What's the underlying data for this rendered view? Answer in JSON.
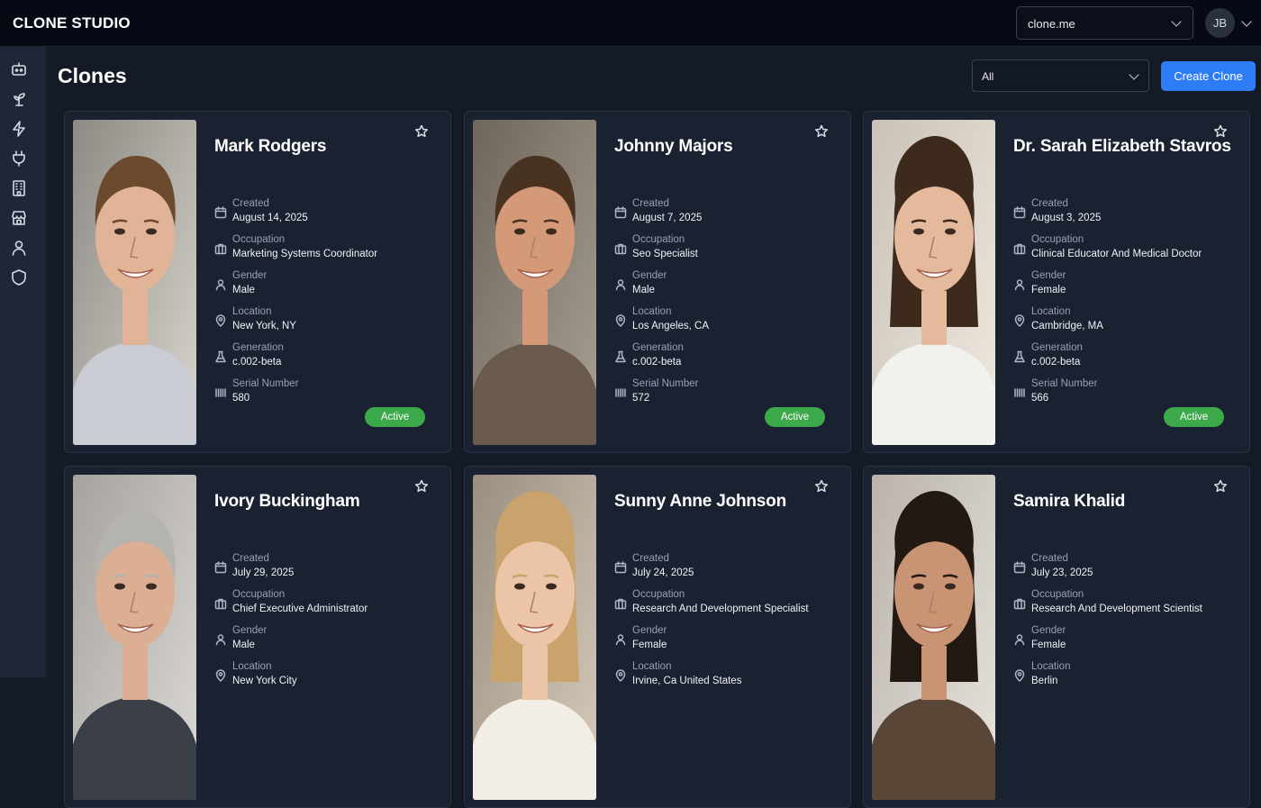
{
  "app": {
    "brand": "CLONE STUDIO"
  },
  "header": {
    "domain_selector": {
      "value": "clone.me"
    },
    "user": {
      "initials": "JB"
    }
  },
  "sidebar": {
    "items": [
      {
        "icon": "robot-icon"
      },
      {
        "icon": "sprout-icon"
      },
      {
        "icon": "lightning-icon"
      },
      {
        "icon": "plug-icon"
      },
      {
        "icon": "building-icon"
      },
      {
        "icon": "store-icon"
      },
      {
        "icon": "user-icon"
      },
      {
        "icon": "shield-icon"
      }
    ]
  },
  "main": {
    "title": "Clones",
    "filter": {
      "value": "All"
    },
    "create_label": "Create Clone"
  },
  "field_labels": {
    "created": "Created",
    "occupation": "Occupation",
    "gender": "Gender",
    "location": "Location",
    "generation": "Generation",
    "serial": "Serial Number"
  },
  "cards": [
    {
      "name": "Mark Rodgers",
      "created": "August 14, 2025",
      "occupation": "Marketing Systems Coordinator",
      "gender": "Male",
      "location": "New York, NY",
      "generation": "c.002-beta",
      "serial": "580",
      "status": "Active"
    },
    {
      "name": "Johnny Majors",
      "created": "August 7, 2025",
      "occupation": "Seo Specialist",
      "gender": "Male",
      "location": "Los Angeles, CA",
      "generation": "c.002-beta",
      "serial": "572",
      "status": "Active"
    },
    {
      "name": "Dr. Sarah Elizabeth Stavros",
      "created": "August 3, 2025",
      "occupation": "Clinical Educator And Medical Doctor",
      "gender": "Female",
      "location": "Cambridge, MA",
      "generation": "c.002-beta",
      "serial": "566",
      "status": "Active"
    },
    {
      "name": "Ivory Buckingham",
      "created": "July 29, 2025",
      "occupation": "Chief Executive Administrator",
      "gender": "Male",
      "location": "New York City"
    },
    {
      "name": "Sunny Anne Johnson",
      "created": "July 24, 2025",
      "occupation": "Research And Development Specialist",
      "gender": "Female",
      "location": "Irvine, Ca United States"
    },
    {
      "name": "Samira Khalid",
      "created": "July 23, 2025",
      "occupation": "Research And Development Scientist",
      "gender": "Female",
      "location": "Berlin"
    }
  ],
  "colors": {
    "accent": "#2f7df6",
    "status_active": "#3ca94a",
    "card_bg": "#1a2130",
    "page_bg": "#141a26"
  }
}
